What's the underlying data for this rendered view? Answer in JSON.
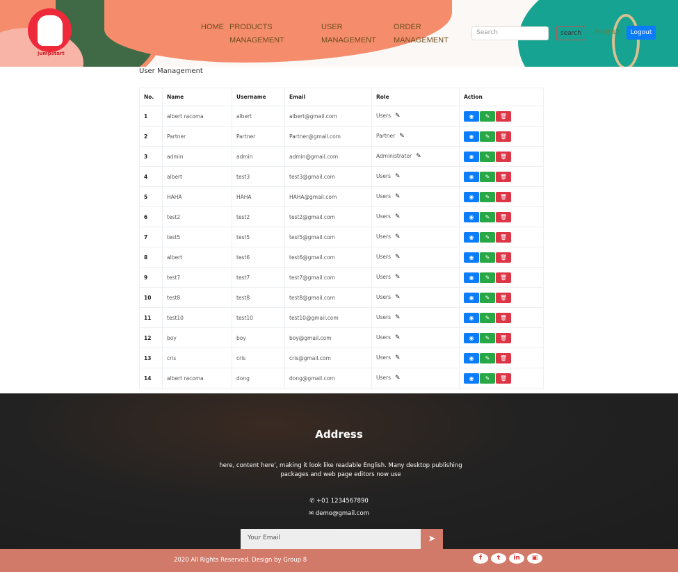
{
  "header": {
    "logo_text": "jumpstart",
    "nav": [
      "HOME",
      "PRODUCTS MANAGEMENT",
      "USER MANAGEMENT",
      "ORDER MANAGEMENT"
    ],
    "search_placeholder": "Search",
    "search_label": "search",
    "profile": "PROFILE",
    "logout": "Logout"
  },
  "page_title": "User Management",
  "table": {
    "headers": [
      "No.",
      "Name",
      "Username",
      "Email",
      "Role",
      "Action"
    ],
    "rows": [
      [
        "1",
        "albert racoma",
        "albert",
        "albert@gmail.com",
        "Users"
      ],
      [
        "2",
        "Partner",
        "Partner",
        "Partner@gmail.com",
        "Partner"
      ],
      [
        "3",
        "admin",
        "admin",
        "admin@gmail.com",
        "Administrator"
      ],
      [
        "4",
        "albert",
        "test3",
        "test3@gmail.com",
        "Users"
      ],
      [
        "5",
        "HAHA",
        "HAHA",
        "HAHA@gmail.com",
        "Users"
      ],
      [
        "6",
        "test2",
        "test2",
        "test2@gmail.com",
        "Users"
      ],
      [
        "7",
        "test5",
        "test5",
        "test5@gmail.com",
        "Users"
      ],
      [
        "8",
        "albert",
        "test6",
        "test6@gmail.com",
        "Users"
      ],
      [
        "9",
        "test7",
        "test7",
        "test7@gmail.com",
        "Users"
      ],
      [
        "10",
        "test8",
        "test8",
        "test8@gmail.com",
        "Users"
      ],
      [
        "11",
        "test10",
        "test10",
        "test10@gmail.com",
        "Users"
      ],
      [
        "12",
        "boy",
        "boy",
        "boy@gmail.com",
        "Users"
      ],
      [
        "13",
        "cris",
        "cris",
        "cris@gmail.com",
        "Users"
      ],
      [
        "14",
        "albert racoma",
        "dong",
        "dong@gmail.com",
        "Users"
      ]
    ]
  },
  "colors": {
    "view": "#0b7dfb",
    "edit": "#28a745",
    "delete": "#dc3545",
    "footer_bar": "#d27a6a"
  },
  "footer": {
    "title": "Address",
    "description": "here, content here', making it look like readable English. Many desktop publishing packages and web page editors now use",
    "phone": "+01 1234567890",
    "email": "demo@gmail.com",
    "email_placeholder": "Your Email",
    "copyright": "2020 All Rights Reserved. Design by Group 8",
    "social": [
      "facebook-icon",
      "twitter-icon",
      "linkedin-icon",
      "instagram-icon"
    ]
  }
}
